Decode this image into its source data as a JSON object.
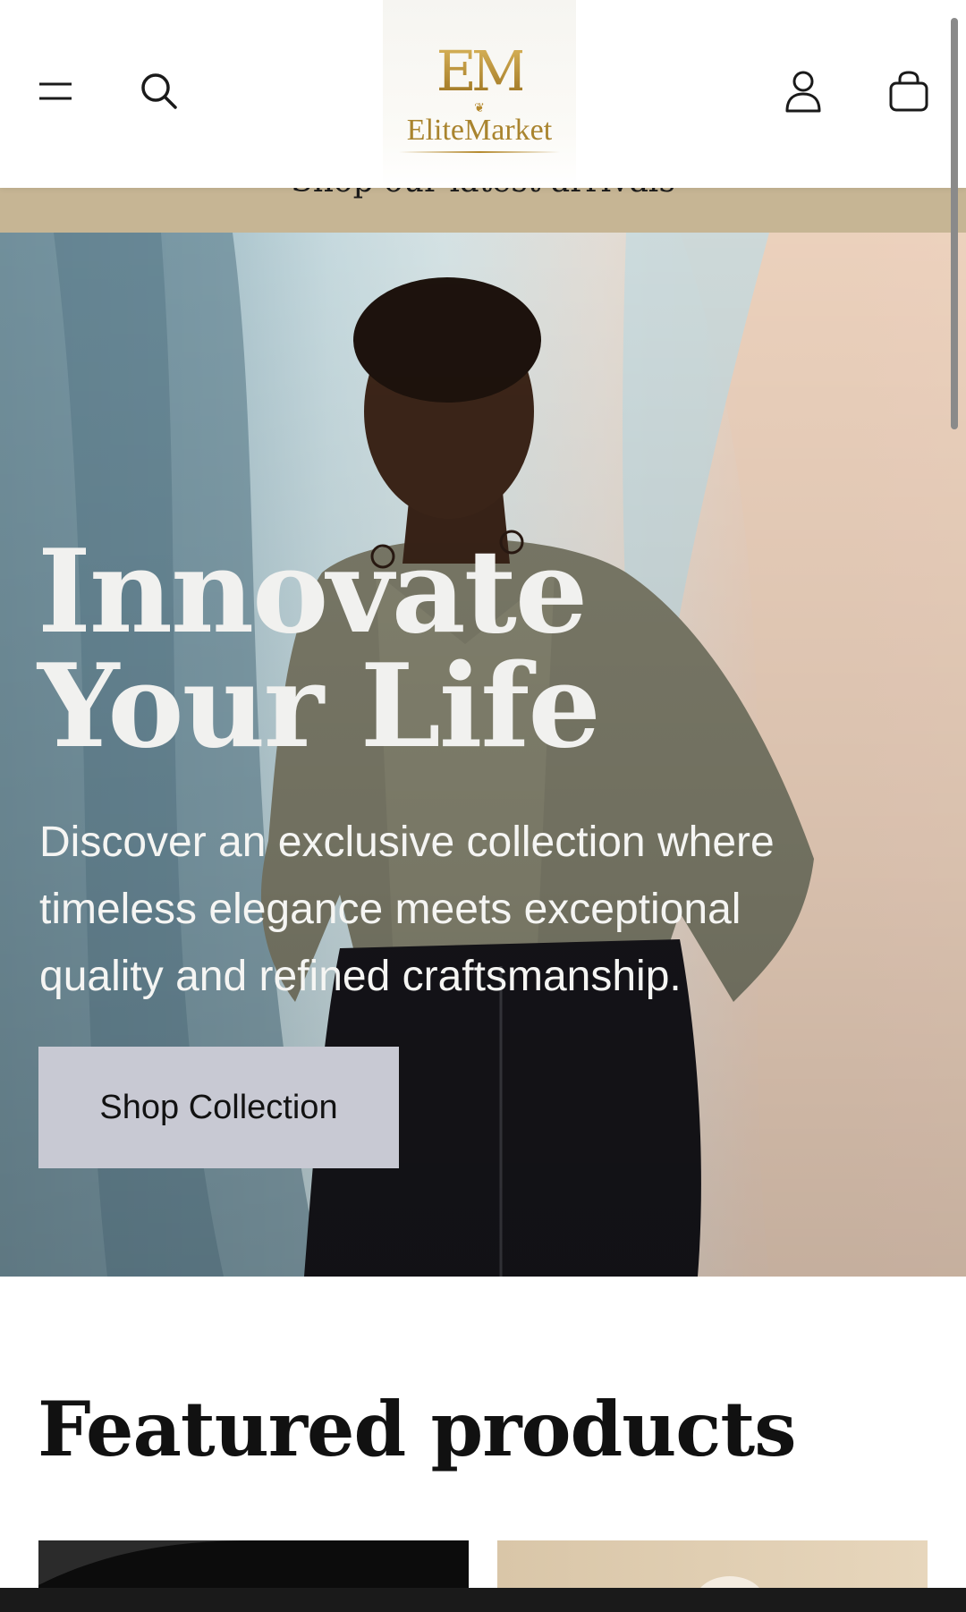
{
  "header": {
    "menu_icon": "hamburger-menu-icon",
    "search_icon": "search-icon",
    "account_icon": "user-icon",
    "cart_icon": "shopping-bag-icon",
    "logo": {
      "monogram": "EM",
      "name": "EliteMarket"
    }
  },
  "announcement": {
    "text": "Shop our latest arrivals"
  },
  "hero": {
    "title_line1": "Innovate",
    "title_line2": "Your Life",
    "subtitle": "Discover an exclusive collection where timeless elegance meets exceptional quality and refined craftsmanship.",
    "button_label": "Shop Collection"
  },
  "featured": {
    "title": "Featured products"
  },
  "colors": {
    "announcement_bg": "#c6b594",
    "button_bg": "#c8c9d3",
    "logo_gold": "#b58a2f"
  }
}
